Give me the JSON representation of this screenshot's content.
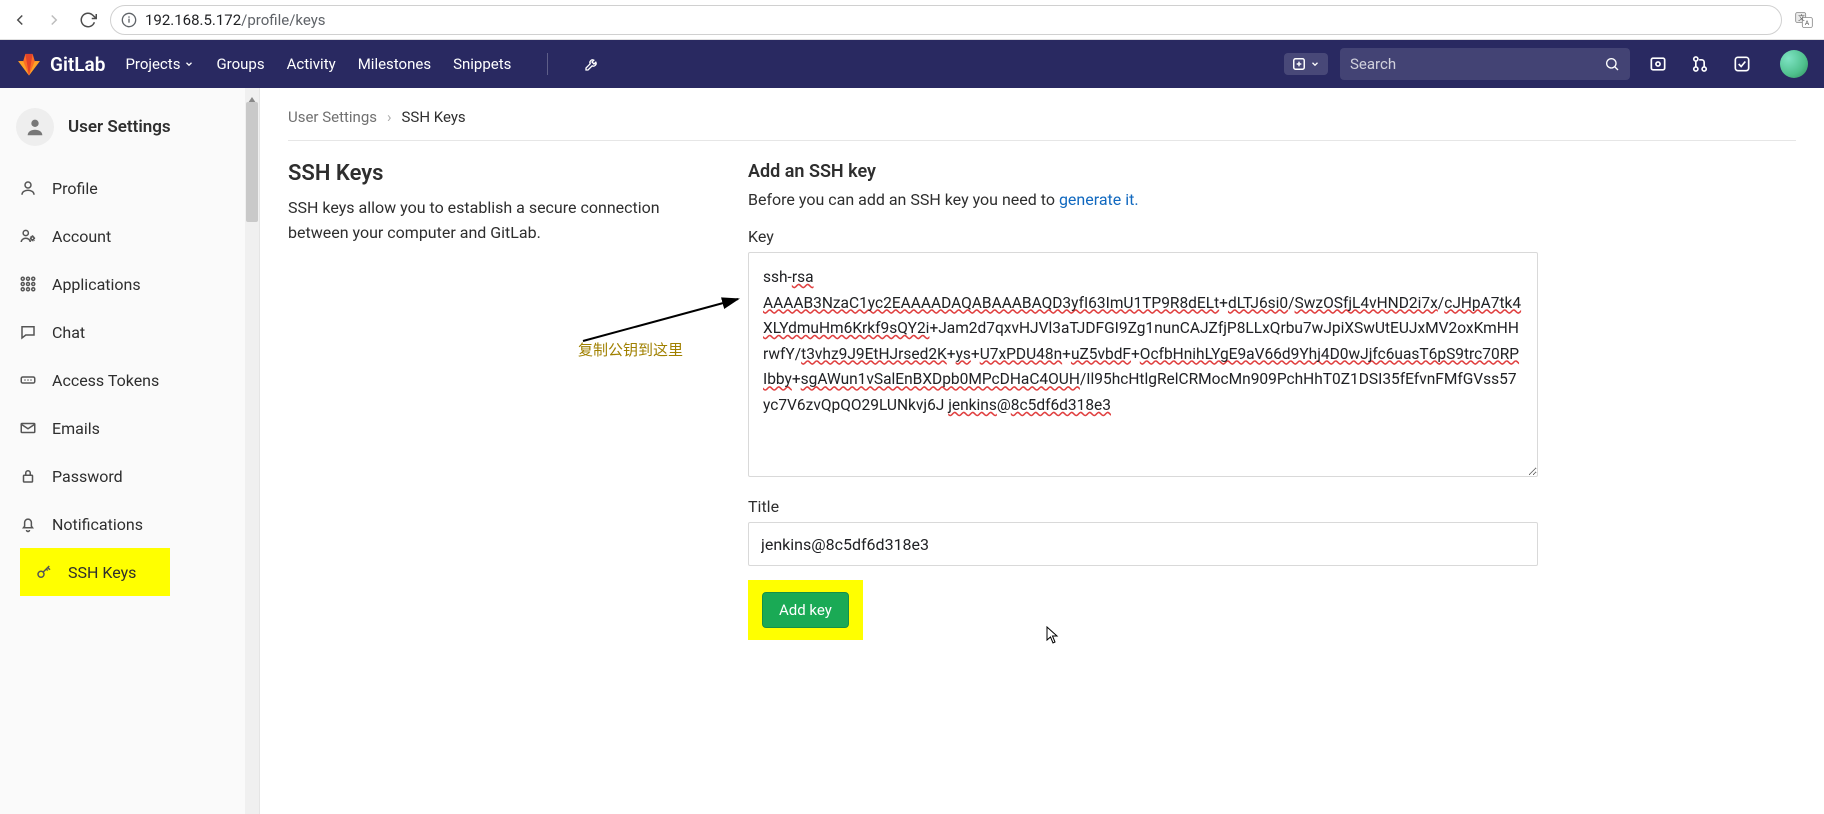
{
  "browser": {
    "url_host": "192.168.5.172",
    "url_path": "/profile/keys"
  },
  "header": {
    "brand": "GitLab",
    "nav": {
      "projects": "Projects",
      "groups": "Groups",
      "activity": "Activity",
      "milestones": "Milestones",
      "snippets": "Snippets"
    },
    "search_placeholder": "Search"
  },
  "sidebar": {
    "title": "User Settings",
    "items": [
      {
        "label": "Profile"
      },
      {
        "label": "Account"
      },
      {
        "label": "Applications"
      },
      {
        "label": "Chat"
      },
      {
        "label": "Access Tokens"
      },
      {
        "label": "Emails"
      },
      {
        "label": "Password"
      },
      {
        "label": "Notifications"
      },
      {
        "label": "SSH Keys"
      }
    ]
  },
  "breadcrumb": {
    "root": "User Settings",
    "current": "SSH Keys"
  },
  "left": {
    "title": "SSH Keys",
    "desc": "SSH keys allow you to establish a secure connection between your computer and GitLab."
  },
  "right": {
    "title": "Add an SSH key",
    "desc_prefix": "Before you can add an SSH key you need to ",
    "generate_link": "generate it.",
    "key_label": "Key",
    "key_value": "ssh-rsa AAAAB3NzaC1yc2EAAAADAQABAAABAQD3yfI63ImU1TP9R8dELt+dLTJ6si0/SwzOSfjL4vHND2i7x/cJHpA7tk4XLYdmuHm6Krkf9sQY2i+Jam2d7qxvHJVl3aTJDFGI9Zg1nunCAJZfjP8LLxQrbu7wJpiXSwUtEUJxMV2oxKmHHrwfY/t3vhz9J9EtHJrsed2K+ys+U7xPDU48n+uZ5vbdF+OcfbHnihLYgE9aV66d9Yhj4D0wJjfc6uasT6pS9trc70RPIbby+sgAWun1vSalEnBXDpb0MPcDHaC4OUH/Il95hcHtlgRelCRMocMn909PchHhT0Z1DSI35fEfvnFMfGVss57yc7V6zvQpQO29LUNkvj6J jenkins@8c5df6d318e3",
    "title_label": "Title",
    "title_value": "jenkins@8c5df6d318e3",
    "add_key": "Add key"
  },
  "annotation": "复制公钥到这里"
}
